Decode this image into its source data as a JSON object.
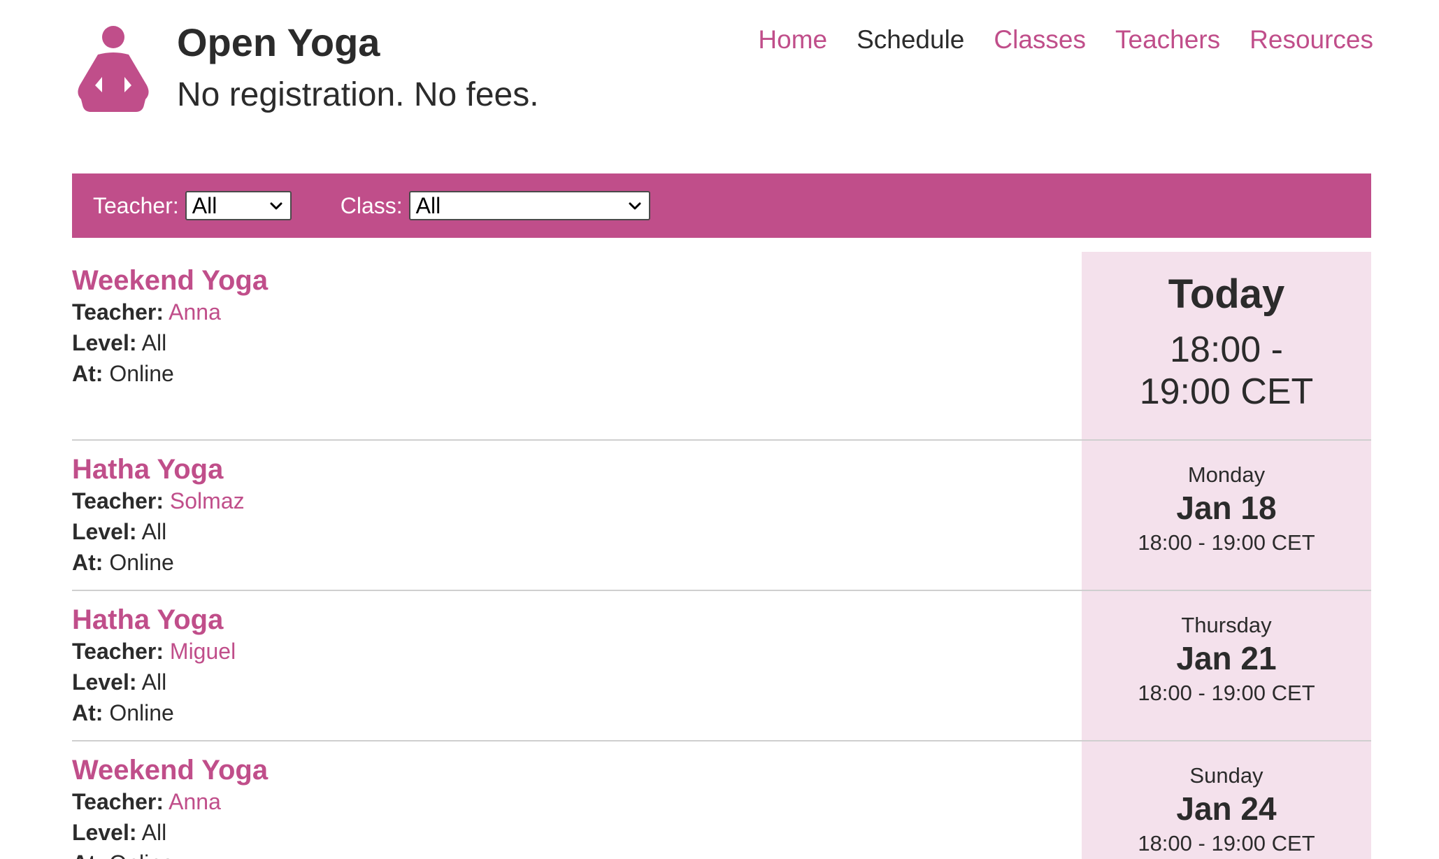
{
  "header": {
    "title": "Open Yoga",
    "tagline": "No registration. No fees."
  },
  "nav": {
    "items": [
      {
        "label": "Home"
      },
      {
        "label": "Schedule"
      },
      {
        "label": "Classes"
      },
      {
        "label": "Teachers"
      },
      {
        "label": "Resources"
      }
    ]
  },
  "filters": {
    "teacher_label": "Teacher:",
    "teacher_value": "All",
    "class_label": "Class:",
    "class_value": "All"
  },
  "labels": {
    "teacher": "Teacher:",
    "level": "Level:",
    "at": "At:"
  },
  "schedule": [
    {
      "name": "Weekend Yoga",
      "teacher": "Anna",
      "level": "All",
      "at": "Online",
      "when_title": "Today",
      "time": "18:00 - 19:00 CET"
    },
    {
      "name": "Hatha Yoga",
      "teacher": "Solmaz",
      "level": "All",
      "at": "Online",
      "day": "Monday",
      "date": "Jan 18",
      "time": "18:00 - 19:00 CET"
    },
    {
      "name": "Hatha Yoga",
      "teacher": "Miguel",
      "level": "All",
      "at": "Online",
      "day": "Thursday",
      "date": "Jan 21",
      "time": "18:00 - 19:00 CET"
    },
    {
      "name": "Weekend Yoga",
      "teacher": "Anna",
      "level": "All",
      "at": "Online",
      "day": "Sunday",
      "date": "Jan 24",
      "time": "18:00 - 19:00 CET"
    }
  ],
  "colors": {
    "accent": "#c04e8a",
    "highlight_bg": "#f4e1ec",
    "text": "#2b2b2b"
  },
  "icons": {
    "logo": "meditating-person-icon",
    "select_arrow": "chevron-down-icon"
  }
}
